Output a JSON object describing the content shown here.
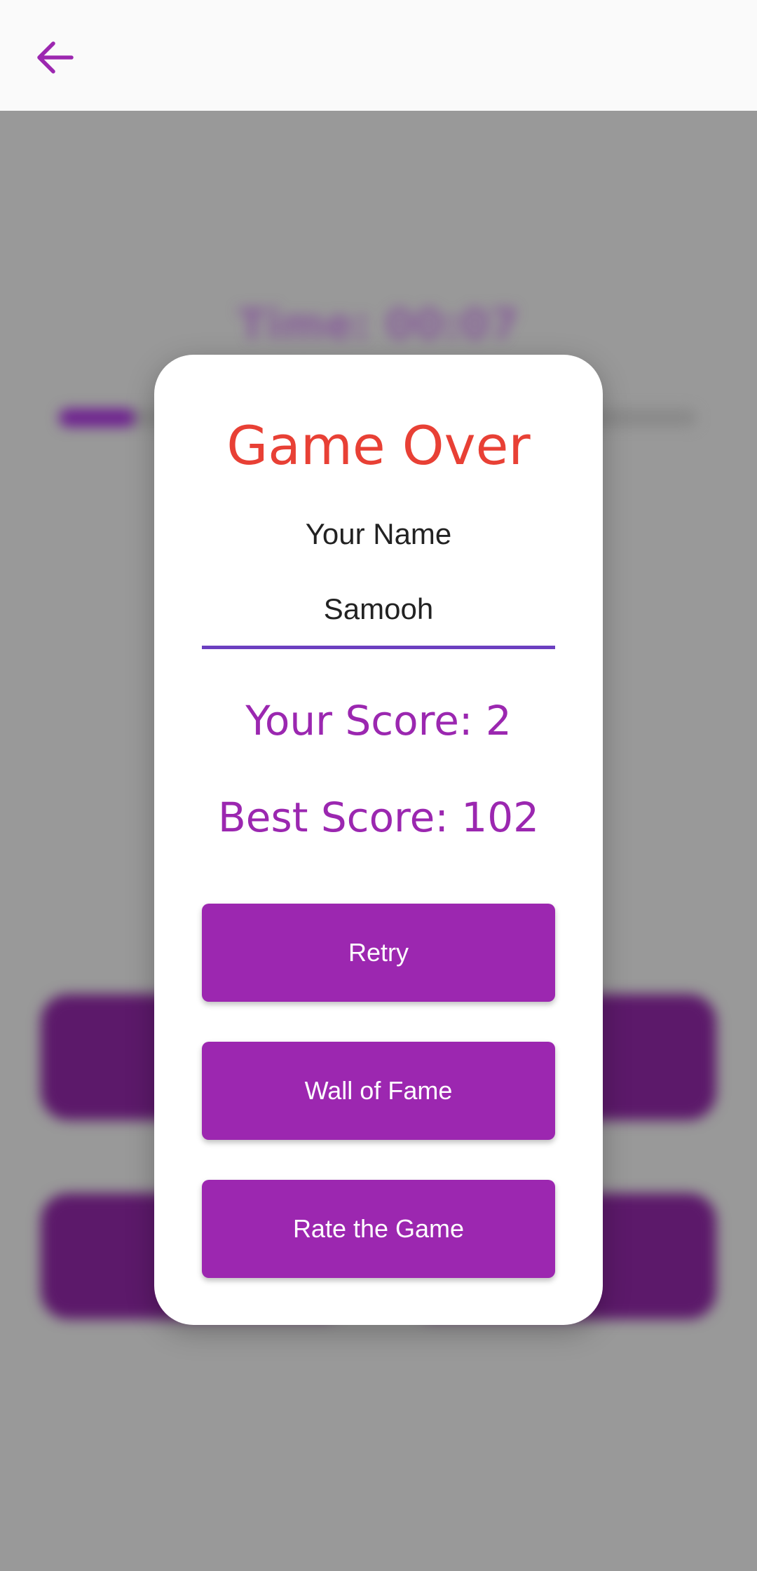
{
  "colors": {
    "accent": "#9c27b0",
    "title_red": "#e84035",
    "input_underline": "#6b3fc0",
    "scrim": "#999999"
  },
  "app_bar": {
    "back_icon": "arrow-back-icon"
  },
  "background": {
    "timer_text": "Time: 00:07",
    "progress": 0.12
  },
  "dialog": {
    "title": "Game Over",
    "name_label": "Your Name",
    "name_value": "Samooh",
    "your_score": "Your Score: 2",
    "best_score": "Best Score: 102",
    "buttons": {
      "retry": "Retry",
      "wall_of_fame": "Wall of Fame",
      "rate": "Rate the Game"
    }
  }
}
